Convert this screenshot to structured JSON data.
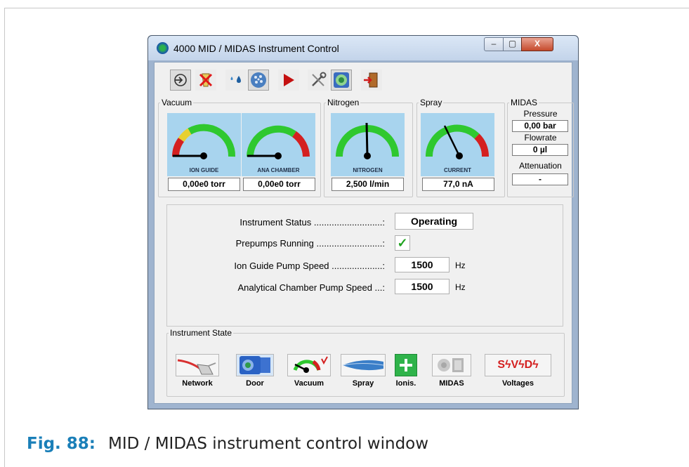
{
  "window": {
    "title": "4000 MID / MIDAS Instrument Control",
    "min_label": "‒",
    "max_label": "▢",
    "close_label": "X"
  },
  "toolbar": {
    "buttons": [
      {
        "icon": "connect-icon"
      },
      {
        "icon": "disconnect-icon"
      },
      {
        "icon": "drops-icon"
      },
      {
        "icon": "spray-icon"
      },
      {
        "icon": "play-icon"
      },
      {
        "icon": "tools-icon"
      },
      {
        "icon": "midas-icon"
      },
      {
        "icon": "exit-icon"
      }
    ]
  },
  "vacuum": {
    "title": "Vacuum",
    "ion_guide": {
      "label": "ION GUIDE",
      "value": "0,00e0 torr"
    },
    "ana_chamber": {
      "label": "ANA CHAMBER",
      "value": "0,00e0 torr"
    }
  },
  "nitrogen": {
    "title": "Nitrogen",
    "label": "NITROGEN",
    "value": "2,500 l/min"
  },
  "spray": {
    "title": "Spray",
    "label": "CURRENT",
    "value": "77,0 nA"
  },
  "midas": {
    "title": "MIDAS",
    "pressure_label": "Pressure",
    "pressure_value": "0,00 bar",
    "flowrate_label": "Flowrate",
    "flowrate_value": "0 µl",
    "attenuation_label": "Attenuation",
    "attenuation_value": "-"
  },
  "status": {
    "instrument_status_label": "Instrument Status ...........................:",
    "instrument_status_value": "Operating",
    "prepumps_label": "Prepumps Running ..........................:",
    "prepumps_value": "✓",
    "ion_guide_speed_label": "Ion Guide Pump Speed ....................:",
    "ion_guide_speed_value": "1500",
    "ion_guide_speed_unit": "Hz",
    "analytical_speed_label": "Analytical Chamber Pump Speed ...:",
    "analytical_speed_value": "1500",
    "analytical_speed_unit": "Hz"
  },
  "instrument_state": {
    "title": "Instrument State",
    "items": [
      {
        "label": "Network"
      },
      {
        "label": "Door"
      },
      {
        "label": "Vacuum"
      },
      {
        "label": "Spray"
      },
      {
        "label": "Ionis."
      },
      {
        "label": "MIDAS"
      },
      {
        "label": "Voltages"
      }
    ],
    "voltages_text": "SϟVϟDϟ"
  },
  "caption": {
    "number": "Fig. 88:",
    "text": "MID / MIDAS instrument control window"
  },
  "colors": {
    "gauge_bg": "#a8d4ee",
    "gauge_green": "#2fc82f",
    "gauge_red": "#d42020",
    "gauge_yellow": "#e8d030",
    "accent_blue": "#1a7fb8",
    "check_green": "#1fa31f"
  }
}
